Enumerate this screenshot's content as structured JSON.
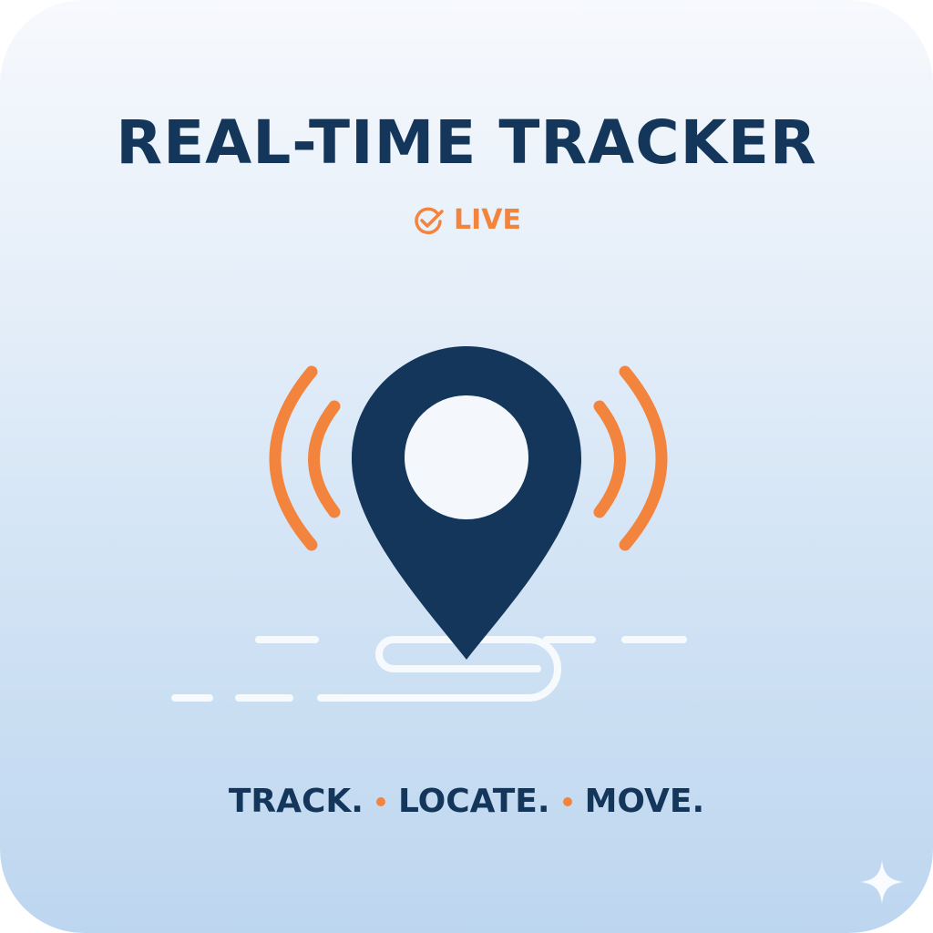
{
  "header": {
    "title": "REAL-TIME TRACKER"
  },
  "status": {
    "label": "LIVE",
    "icon": "check-circle-icon"
  },
  "illustration": {
    "pin_icon": "map-pin-icon",
    "signal_icon": "signal-waves-icon",
    "route_icon": "route-path-icon"
  },
  "tagline": {
    "items": [
      "TRACK.",
      "LOCATE.",
      "MOVE."
    ]
  },
  "corner_icon": "sparkle-icon",
  "colors": {
    "primary": "#14365a",
    "accent": "#f3843e",
    "background_top": "#f7f9fd",
    "background_bottom": "#bdd6ef",
    "route": "#ffffff"
  }
}
